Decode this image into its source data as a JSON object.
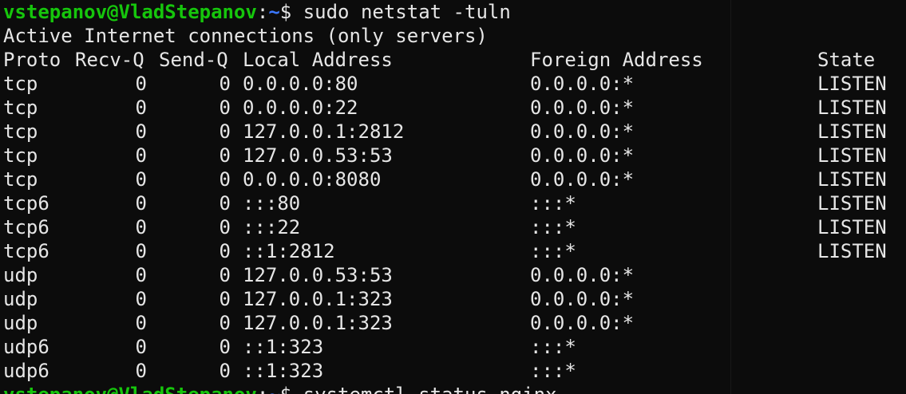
{
  "prompt1": {
    "user_host": "vstepanov@VladStepanov",
    "colon": ":",
    "path": "~",
    "dollar": "$",
    "command": " sudo netstat -tuln"
  },
  "output_title": "Active Internet connections (only servers)",
  "headers": {
    "proto": "Proto",
    "recvq": "Recv-Q",
    "sendq": "Send-Q",
    "local": "Local Address",
    "foreign": "Foreign Address",
    "state": "State"
  },
  "rows": [
    {
      "proto": "tcp",
      "recvq": "0",
      "sendq": "0",
      "local": "0.0.0.0:80",
      "foreign": "0.0.0.0:*",
      "state": "LISTEN"
    },
    {
      "proto": "tcp",
      "recvq": "0",
      "sendq": "0",
      "local": "0.0.0.0:22",
      "foreign": "0.0.0.0:*",
      "state": "LISTEN"
    },
    {
      "proto": "tcp",
      "recvq": "0",
      "sendq": "0",
      "local": "127.0.0.1:2812",
      "foreign": "0.0.0.0:*",
      "state": "LISTEN"
    },
    {
      "proto": "tcp",
      "recvq": "0",
      "sendq": "0",
      "local": "127.0.0.53:53",
      "foreign": "0.0.0.0:*",
      "state": "LISTEN"
    },
    {
      "proto": "tcp",
      "recvq": "0",
      "sendq": "0",
      "local": "0.0.0.0:8080",
      "foreign": "0.0.0.0:*",
      "state": "LISTEN"
    },
    {
      "proto": "tcp6",
      "recvq": "0",
      "sendq": "0",
      "local": ":::80",
      "foreign": ":::*",
      "state": "LISTEN"
    },
    {
      "proto": "tcp6",
      "recvq": "0",
      "sendq": "0",
      "local": ":::22",
      "foreign": ":::*",
      "state": "LISTEN"
    },
    {
      "proto": "tcp6",
      "recvq": "0",
      "sendq": "0",
      "local": "::1:2812",
      "foreign": ":::*",
      "state": "LISTEN"
    },
    {
      "proto": "udp",
      "recvq": "0",
      "sendq": "0",
      "local": "127.0.0.53:53",
      "foreign": "0.0.0.0:*",
      "state": ""
    },
    {
      "proto": "udp",
      "recvq": "0",
      "sendq": "0",
      "local": "127.0.0.1:323",
      "foreign": "0.0.0.0:*",
      "state": ""
    },
    {
      "proto": "udp",
      "recvq": "0",
      "sendq": "0",
      "local": "127.0.0.1:323",
      "foreign": "0.0.0.0:*",
      "state": ""
    },
    {
      "proto": "udp6",
      "recvq": "0",
      "sendq": "0",
      "local": "::1:323",
      "foreign": ":::*",
      "state": ""
    },
    {
      "proto": "udp6",
      "recvq": "0",
      "sendq": "0",
      "local": "::1:323",
      "foreign": ":::*",
      "state": ""
    }
  ],
  "prompt2": {
    "user_host": "vstepanov@VladStepanov",
    "colon": ":",
    "path": "~",
    "dollar": "$",
    "command": " systemctl status nginx"
  },
  "colors": {
    "background": "#0c0c0c",
    "text": "#e6e6e6",
    "user_host": "#16c60c",
    "path": "#3b78ff"
  }
}
